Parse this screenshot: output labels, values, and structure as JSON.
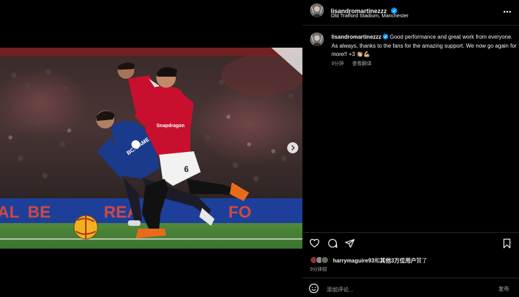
{
  "post": {
    "username": "lisandromartinezzz",
    "location": "Old Trafford Stadium, Manchester",
    "more_icon": "more-horizontal-icon"
  },
  "media": {
    "description_icon": "chevron-right-icon",
    "photo_icon": "football-match-photo",
    "kit_sponsor": "Snapdragon",
    "shirt_number": "6",
    "opponent_sponsor": "BC.GAME"
  },
  "caption": {
    "username": "lisandromartinezzz",
    "text": "Good performance and great work from everyone. As always, thanks to the fans for the amazing support. We now go again for more!! +3",
    "emoji": "👏🏼💪🏼",
    "time": "9分钟",
    "translate": "查看翻译"
  },
  "actions": {
    "like_icon": "heart-icon",
    "comment_icon": "comment-icon",
    "share_icon": "send-icon",
    "save_icon": "bookmark-icon"
  },
  "likes": {
    "prefix_user": "harrymaguire93",
    "middle": "和",
    "others": "其他3万位用户",
    "suffix": "赞了"
  },
  "timestamp": "9分钟前",
  "comment": {
    "placeholder": "添加评论...",
    "post_label": "发布",
    "emoji_icon": "smiley-icon"
  },
  "colors": {
    "verified": "#0095f6",
    "muted": "#a8a8a8",
    "divider": "#262626",
    "united_red": "#c8102e",
    "leicester_blue": "#1a3a8c"
  }
}
